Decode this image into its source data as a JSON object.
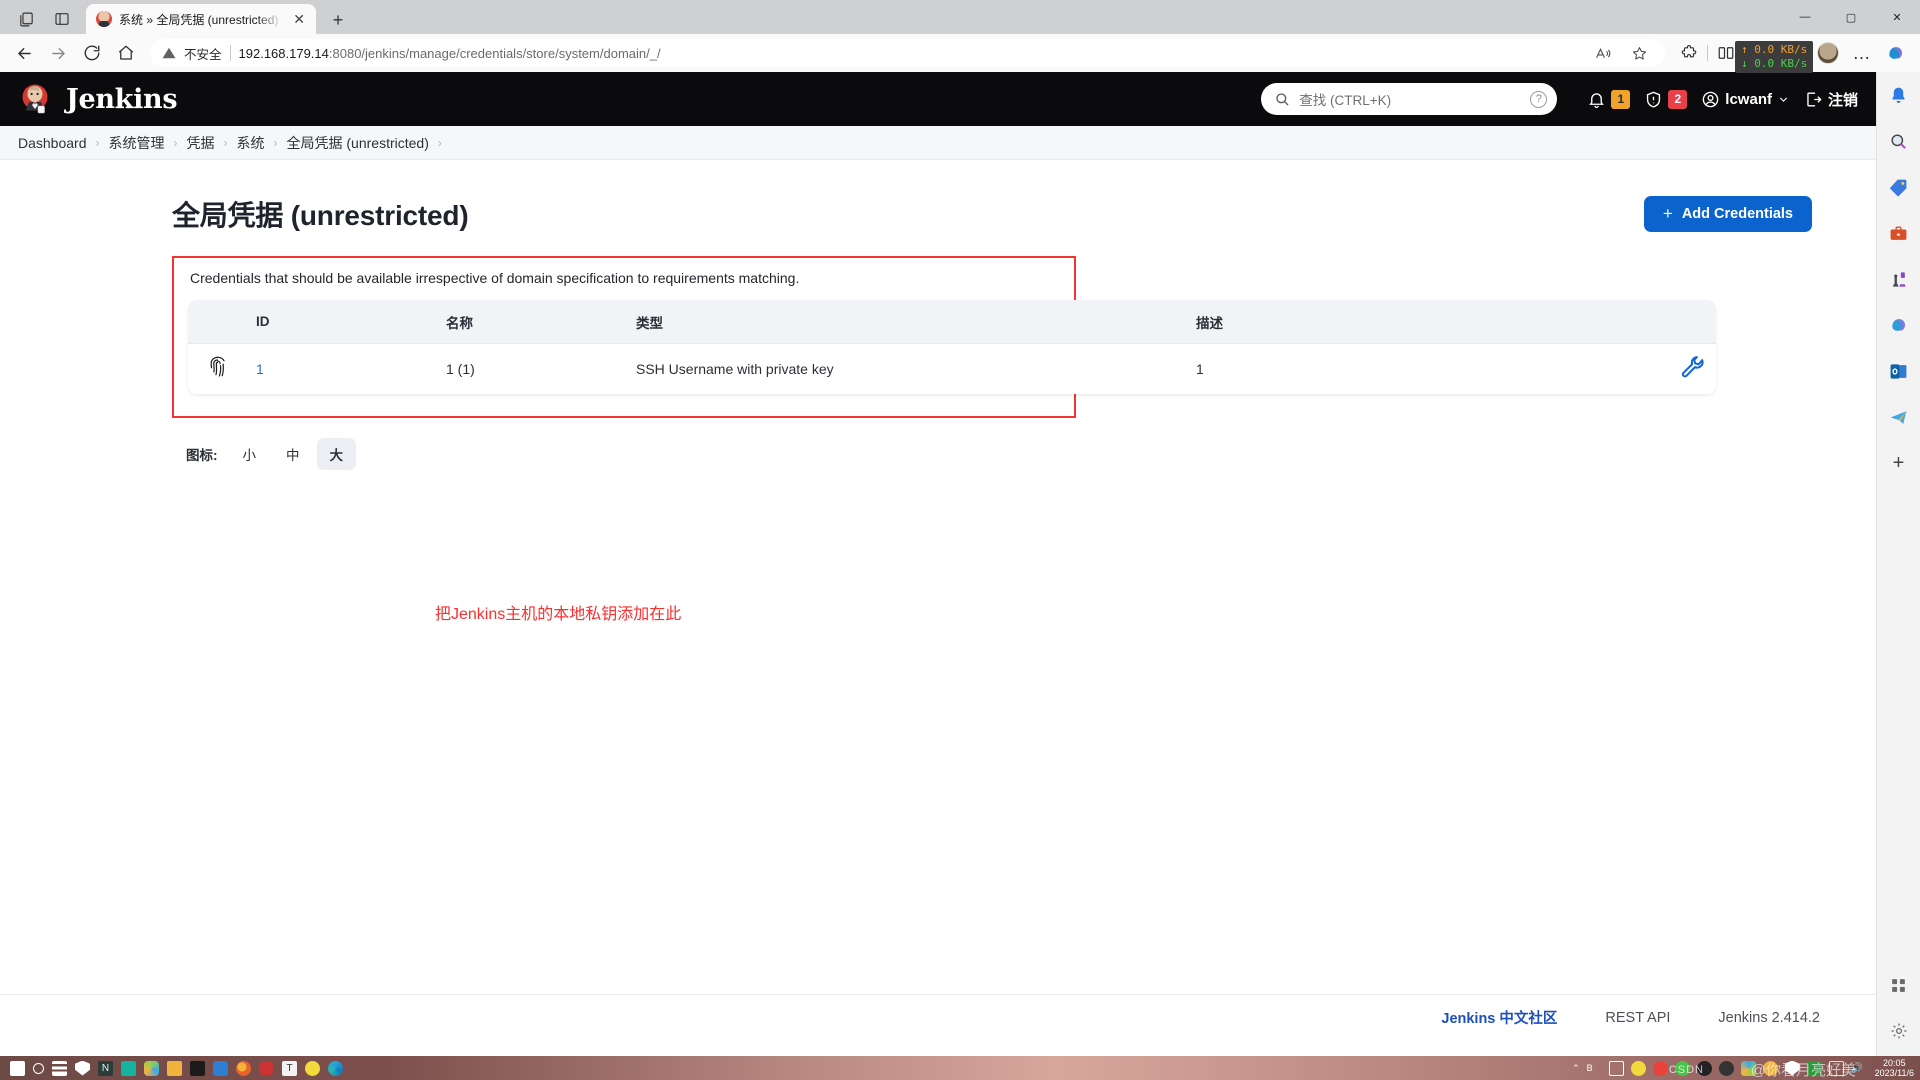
{
  "browser": {
    "tab": {
      "title": "系统 » 全局凭据 (unrestricted) [Je",
      "favicon": "jenkins-favicon",
      "close": "✕"
    },
    "newtab_label": "+",
    "window_controls": {
      "minimize": "—",
      "maximize": "▢",
      "close": "✕"
    },
    "nav": {
      "back": "←",
      "forward": "→",
      "reload": "⟳",
      "home": "⌂",
      "security_label": "不安全",
      "url_host": "192.168.179.14",
      "url_rest": ":8080/jenkins/manage/credentials/store/system/domain/_/",
      "read_aloud": "A",
      "favorite": "☆",
      "extensions": "⚘",
      "split_screen": "⫿⫾",
      "collections": "⊞",
      "performance": "♥",
      "profile": "avatar",
      "more": "…",
      "copilot": "copilot"
    },
    "netspeed": {
      "up": "↑ 0.0 KB/s",
      "down": "↓ 0.0 KB/s"
    }
  },
  "jenkins": {
    "brand": "Jenkins",
    "search": {
      "placeholder": "查找 (CTRL+K)",
      "help": "?"
    },
    "notifications_count": "1",
    "security_count": "2",
    "user": "lcwanf",
    "logout": "注销",
    "breadcrumbs": [
      "Dashboard",
      "系统管理",
      "凭据",
      "系统",
      "全局凭据 (unrestricted)"
    ],
    "breadcrumb_sep": "›",
    "page_title": "全局凭据 (unrestricted)",
    "add_credentials_label": "Add Credentials",
    "add_credentials_plus": "+",
    "description": "Credentials that should be available irrespective of domain specification to requirements matching.",
    "table": {
      "headers": [
        "",
        "ID",
        "名称",
        "类型",
        "描述",
        ""
      ],
      "rows": [
        {
          "icon": "fingerprint-icon",
          "id": "1",
          "name": "1 (1)",
          "type": "SSH Username with private key",
          "description": "1",
          "action": "wrench-icon"
        }
      ]
    },
    "icon_size": {
      "label": "图标:",
      "options": [
        "小",
        "中",
        "大"
      ],
      "selected": "大"
    },
    "annotation": "把Jenkins主机的本地私钥添加在此",
    "footer": {
      "community_link": "Jenkins 中文社区",
      "rest_api": "REST API",
      "version": "Jenkins 2.414.2"
    }
  },
  "edge_rail": {
    "items": [
      "notifications-bell-icon",
      "search-icon",
      "shopping-tag-icon",
      "tools-briefcase-icon",
      "games-icon",
      "copilot-icon",
      "outlook-icon",
      "telegram-icon",
      "add-icon"
    ],
    "bottom_items": [
      "apps-icon",
      "settings-gear-icon"
    ]
  },
  "taskbar": {
    "time": "20:05",
    "date": "2023/11/6",
    "watermark": "@你看月亮好美",
    "csdn": "CSDN",
    "left_apps": [
      "start-icon",
      "search-icon",
      "task-view-icon",
      "defender-icon",
      "notepad-icon",
      "wps-icon",
      "photos-icon",
      "file-explorer-icon",
      "nvidia-icon",
      "vmware-icon",
      "firefox-icon",
      "snail-icon",
      "typora-icon",
      "music-icon",
      "edge-icon"
    ],
    "tray_apps": [
      "chevron-up-icon",
      "bilibili-icon",
      "screen-recorder-icon",
      "music-tray-icon",
      "qq-icon",
      "wechat-icon",
      "gamecenter-icon",
      "at-icon",
      "apps-tray-icon",
      "flame-icon",
      "shield-icon",
      "monitor-icon",
      "keyboard-icon",
      "volume-icon"
    ]
  }
}
